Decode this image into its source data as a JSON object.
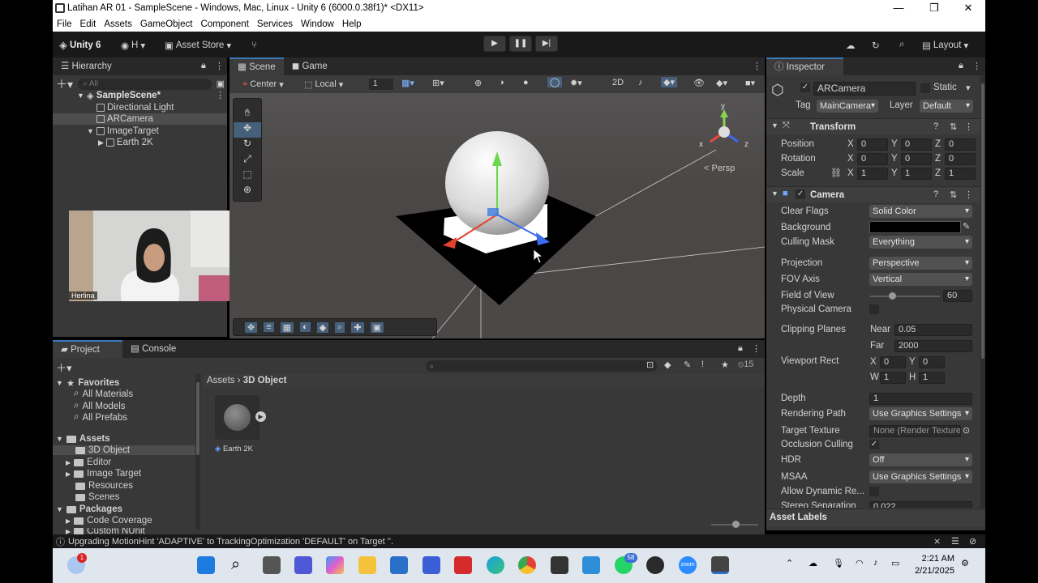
{
  "window": {
    "title": "Latihan AR 01 - SampleScene - Windows, Mac, Linux - Unity 6 (6000.0.38f1)* <DX11>"
  },
  "menu": [
    "File",
    "Edit",
    "Assets",
    "GameObject",
    "Component",
    "Services",
    "Window",
    "Help"
  ],
  "toolbar": {
    "logo": "Unity 6",
    "account": "H",
    "asset_store": "Asset Store",
    "layout": "Layout"
  },
  "hierarchy": {
    "tab": "Hierarchy",
    "search_placeholder": "All",
    "scene": "SampleScene*",
    "items": [
      "Directional Light",
      "ARCamera",
      "ImageTarget",
      "Earth 2K"
    ]
  },
  "scene_view": {
    "tabs": [
      "Scene",
      "Game"
    ],
    "pivot": "Center",
    "space": "Local",
    "grid_value": "1",
    "persp_label": "< Persp",
    "gizmo_axes": {
      "x": "x",
      "y": "y",
      "z": "z"
    }
  },
  "webcam": {
    "name": "Herlina"
  },
  "inspector": {
    "tab": "Inspector",
    "object_name": "ARCamera",
    "static_label": "Static",
    "tag_label": "Tag",
    "tag_value": "MainCamera",
    "layer_label": "Layer",
    "layer_value": "Default",
    "transform": {
      "title": "Transform",
      "position": {
        "label": "Position",
        "x": "0",
        "y": "0",
        "z": "0"
      },
      "rotation": {
        "label": "Rotation",
        "x": "0",
        "y": "0",
        "z": "0"
      },
      "scale": {
        "label": "Scale",
        "x": "1",
        "y": "1",
        "z": "1"
      }
    },
    "camera": {
      "title": "Camera",
      "clear_flags": {
        "label": "Clear Flags",
        "value": "Solid Color"
      },
      "background": {
        "label": "Background",
        "color": "#000000"
      },
      "culling_mask": {
        "label": "Culling Mask",
        "value": "Everything"
      },
      "projection": {
        "label": "Projection",
        "value": "Perspective"
      },
      "fov_axis": {
        "label": "FOV Axis",
        "value": "Vertical"
      },
      "field_of_view": {
        "label": "Field of View",
        "value": "60"
      },
      "physical_camera": {
        "label": "Physical Camera"
      },
      "clipping": {
        "label": "Clipping Planes",
        "near_label": "Near",
        "near": "0.05",
        "far_label": "Far",
        "far": "2000"
      },
      "viewport": {
        "label": "Viewport Rect",
        "x": "0",
        "y": "0",
        "w": "1",
        "h": "1"
      },
      "depth": {
        "label": "Depth",
        "value": "1"
      },
      "rendering_path": {
        "label": "Rendering Path",
        "value": "Use Graphics Settings"
      },
      "target_texture": {
        "label": "Target Texture",
        "value": "None (Render Texture)"
      },
      "occlusion": {
        "label": "Occlusion Culling"
      },
      "hdr": {
        "label": "HDR",
        "value": "Off"
      },
      "msaa": {
        "label": "MSAA",
        "value": "Use Graphics Settings"
      },
      "dynamic_res": {
        "label": "Allow Dynamic Re..."
      },
      "stereo": {
        "label": "Stereo Separation",
        "value": "0.022"
      }
    },
    "asset_labels": "Asset Labels"
  },
  "project": {
    "tabs": [
      "Project",
      "Console"
    ],
    "hidden_count": "15",
    "favorites": {
      "label": "Favorites",
      "items": [
        "All Materials",
        "All Models",
        "All Prefabs"
      ]
    },
    "assets": {
      "label": "Assets",
      "items": [
        "3D Object",
        "Editor",
        "Image Target",
        "Resources",
        "Scenes"
      ]
    },
    "packages": {
      "label": "Packages",
      "items": [
        "Code Coverage",
        "Custom NUnit"
      ]
    },
    "breadcrumb": [
      "Assets",
      "3D Object"
    ],
    "files": [
      {
        "name": "Earth 2K"
      }
    ]
  },
  "status": {
    "message": "Upgrading MotionHint 'ADAPTIVE' to TrackingOptimization 'DEFAULT' on Target ''."
  },
  "taskbar": {
    "time": "2:21 AM",
    "date": "2/21/2025",
    "badge_whatsapp": "58",
    "badge_notify": "1",
    "zoom_label": "zoom"
  },
  "colors": {
    "accent": "#3a79bb",
    "panel": "#383838",
    "toolbar": "#191919"
  }
}
